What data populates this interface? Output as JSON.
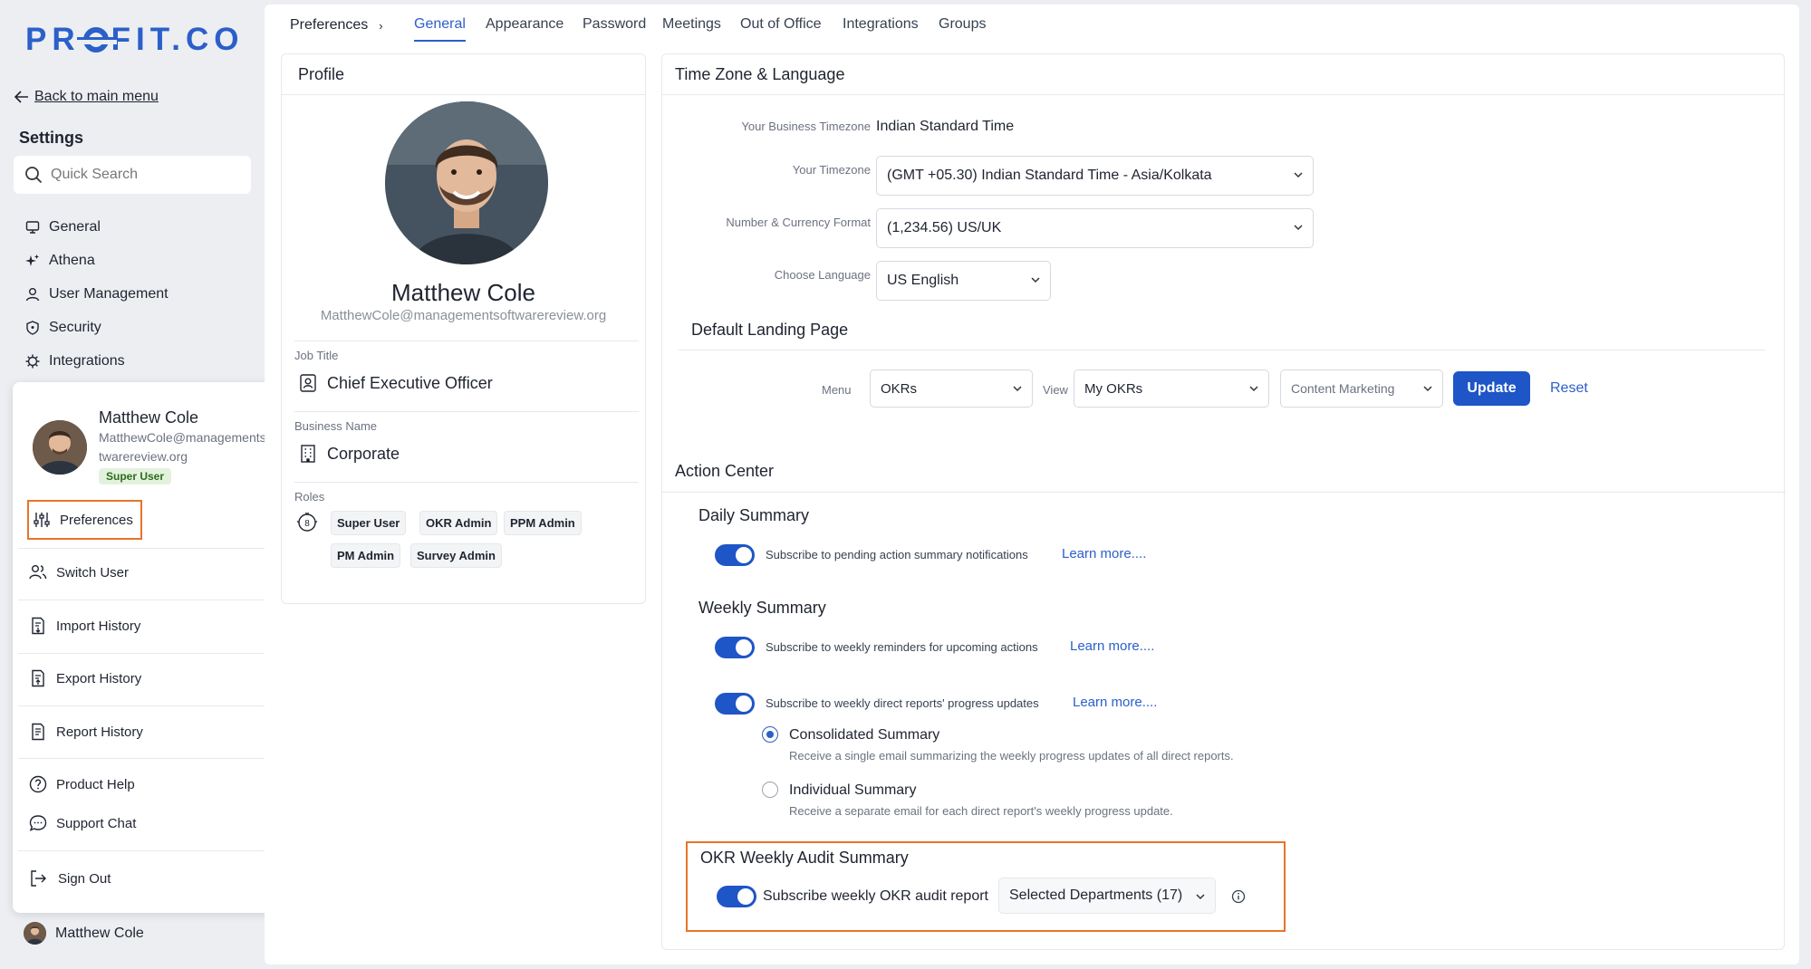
{
  "brand": {
    "logo_pre": "PR",
    "logo_post": "FIT.CO"
  },
  "sidebar": {
    "back_label": "Back to main menu",
    "settings_title": "Settings",
    "search_placeholder": "Quick Search",
    "items": [
      {
        "label": "General",
        "icon": "monitor-icon"
      },
      {
        "label": "Athena",
        "icon": "sparkle-icon"
      },
      {
        "label": "User Management",
        "icon": "user-icon"
      },
      {
        "label": "Security",
        "icon": "shield-icon"
      },
      {
        "label": "Integrations",
        "icon": "gear-icon"
      }
    ],
    "footer_user": "Matthew Cole"
  },
  "user_menu": {
    "name": "Matthew Cole",
    "email": "MatthewCole@managementsoftwarereview.org",
    "badge": "Super User",
    "items": [
      {
        "label": "Preferences",
        "icon": "sliders-icon"
      },
      {
        "label": "Switch User",
        "icon": "users-icon"
      },
      {
        "label": "Import History",
        "icon": "import-doc-icon"
      },
      {
        "label": "Export History",
        "icon": "export-doc-icon"
      },
      {
        "label": "Report History",
        "icon": "report-doc-icon"
      },
      {
        "label": "Product Help",
        "icon": "help-circle-icon"
      },
      {
        "label": "Support Chat",
        "icon": "chat-icon"
      },
      {
        "label": "Sign Out",
        "icon": "sign-out-icon"
      }
    ]
  },
  "tabs": {
    "breadcrumb": "Preferences",
    "items": [
      "General",
      "Appearance",
      "Password",
      "Meetings",
      "Out of Office",
      "Integrations",
      "Groups"
    ],
    "active": "General"
  },
  "profile": {
    "title": "Profile",
    "name": "Matthew Cole",
    "email": "MatthewCole@managementsoftwarereview.org",
    "job_title_label": "Job Title",
    "job_title": "Chief Executive Officer",
    "business_label": "Business Name",
    "business": "Corporate",
    "roles_label": "Roles",
    "roles": [
      "Super User",
      "OKR Admin",
      "PPM Admin",
      "PM Admin",
      "Survey Admin"
    ]
  },
  "timezone": {
    "title": "Time Zone & Language",
    "business_tz_label": "Your Business Timezone",
    "business_tz": "Indian Standard Time",
    "tz_label": "Your Timezone",
    "tz_value": "(GMT +05.30) Indian Standard Time - Asia/Kolkata",
    "format_label": "Number & Currency Format",
    "format_value": "(1,234.56) US/UK",
    "lang_label": "Choose Language",
    "lang_value": "US English"
  },
  "landing": {
    "title": "Default Landing Page",
    "menu_label": "Menu",
    "menu_value": "OKRs",
    "view_label": "View",
    "view_value": "My OKRs",
    "third_value": "Content Marketing",
    "update_label": "Update",
    "reset_label": "Reset"
  },
  "action_center": {
    "title": "Action Center",
    "daily_title": "Daily Summary",
    "daily_text": "Subscribe to pending action summary notifications",
    "weekly_title": "Weekly Summary",
    "weekly_text1": "Subscribe to weekly reminders for upcoming actions",
    "weekly_text2": "Subscribe to weekly direct reports' progress updates",
    "learn_more": "Learn more....",
    "consolidated_label": "Consolidated Summary",
    "consolidated_desc": "Receive a single email summarizing the weekly progress updates of all direct reports.",
    "individual_label": "Individual Summary",
    "individual_desc": "Receive a separate email for each direct report's weekly progress update.",
    "audit_title": "OKR Weekly Audit Summary",
    "audit_text": "Subscribe weekly OKR audit report",
    "audit_select": "Selected Departments (17)"
  }
}
